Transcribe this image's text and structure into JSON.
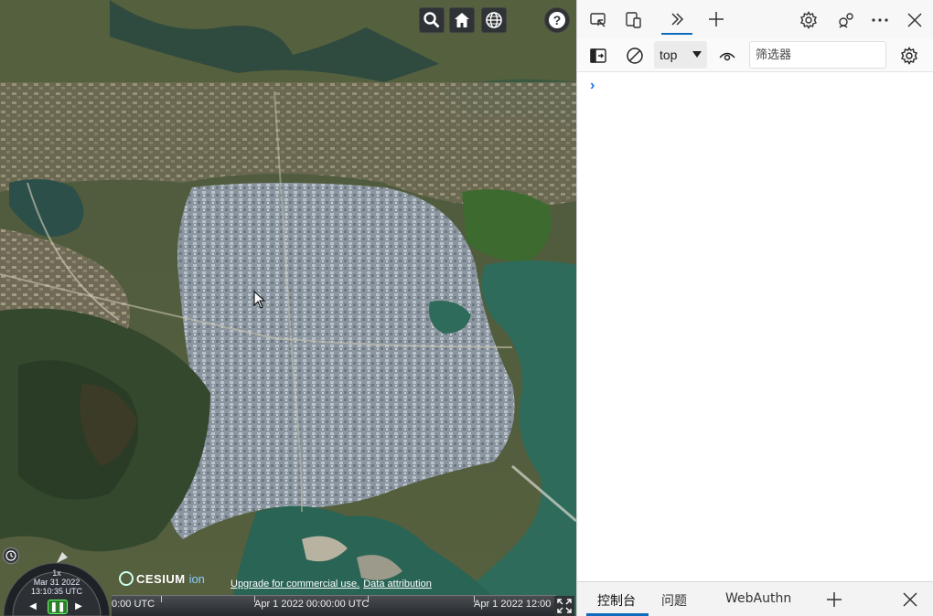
{
  "viewer": {
    "toolbar": [
      {
        "name": "geocoder-search-button",
        "icon": "search-icon"
      },
      {
        "name": "home-button",
        "icon": "home-icon"
      },
      {
        "name": "scene-mode-button",
        "icon": "globe-icon"
      },
      {
        "name": "help-button",
        "icon": "help-icon"
      }
    ],
    "animation": {
      "speed": "1x",
      "date": "Mar 31 2022",
      "time": "13:10:35 UTC"
    },
    "credits": {
      "logo": "CESIUM",
      "logo_suffix": "ion",
      "upgrade_link": "Upgrade for commercial use.",
      "attribution_link": "Data attribution"
    },
    "timeline": {
      "label_1": "0:00 UTC",
      "label_2": "Apr 1 2022 00:00:00 UTC",
      "label_3": "Apr 1 2022 12:00"
    }
  },
  "devtools": {
    "tabs_icons": [
      "inspect-icon",
      "device-emulation-icon",
      "more-tabs-icon",
      "add-tab-icon"
    ],
    "right_icons": [
      "settings-icon",
      "connect-icon",
      "more-options-icon",
      "close-icon"
    ],
    "console_bar": {
      "context": "top",
      "filter_placeholder": "筛选器"
    },
    "prompt_symbol": "›",
    "drawer": {
      "tab_console": "控制台",
      "tab_issues": "问题",
      "tab_webauthn": "WebAuthn"
    }
  },
  "colors": {
    "accent": "#0f6cbd",
    "cesium_toolbar_bg": "#303336",
    "sea": "#2e6b5a"
  }
}
